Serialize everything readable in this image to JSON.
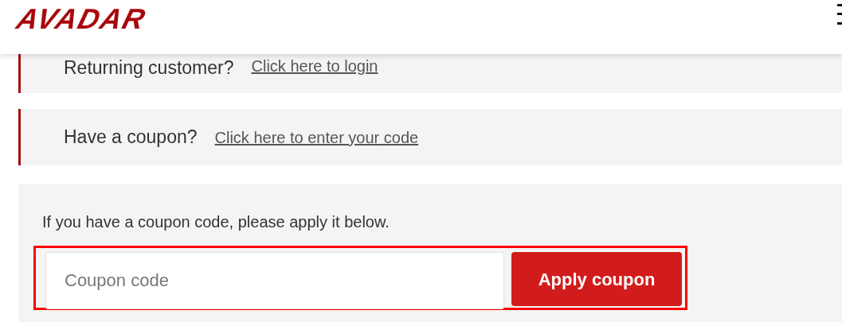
{
  "header": {
    "logo": "AVADAR"
  },
  "notices": [
    {
      "text": "Returning customer?",
      "link": "Click here to login"
    },
    {
      "text": "Have a coupon?",
      "link": "Click here to enter your code"
    }
  ],
  "coupon_form": {
    "instruction": "If you have a coupon code, please apply it below.",
    "placeholder": "Coupon code",
    "button": "Apply coupon",
    "highlighted": true
  }
}
